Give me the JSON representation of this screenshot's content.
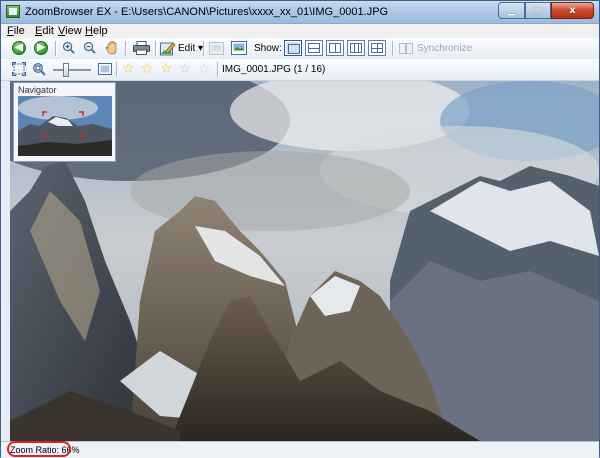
{
  "window": {
    "title": "ZoomBrowser EX - E:\\Users\\CANON\\Pictures\\xxxx_xx_01\\IMG_0001.JPG",
    "min_glyph": "▁",
    "max_glyph": "□",
    "close_glyph": "x"
  },
  "menu": [
    {
      "label": "File",
      "key": "F",
      "rest": "ile"
    },
    {
      "label": "Edit",
      "key": "E",
      "rest": "dit"
    },
    {
      "label": "View",
      "key": "V",
      "rest": "iew"
    },
    {
      "label": "Help",
      "key": "H",
      "rest": "elp"
    }
  ],
  "toolbar": {
    "back_glyph": "◀",
    "forward_glyph": "▶",
    "edit_label": "Edit",
    "edit_arrow": "▾",
    "show_label": "Show:",
    "synchronize_label": "Synchronize",
    "active_view": "single"
  },
  "toolbar2": {
    "zoom_slider_level": 0.35,
    "rating_stars": [
      "☆",
      "☆",
      "☆",
      "☆",
      "☆"
    ],
    "rating_value": 3,
    "file_info": "IMG_0001.JPG (1 / 16)"
  },
  "navigator": {
    "title": "Navigator"
  },
  "status": {
    "zoom_ratio": "Zoom Ratio: 66%"
  },
  "icons": {
    "back": "back-arrow-icon",
    "forward": "forward-arrow-icon",
    "zoom_in": "zoom-in-icon",
    "zoom_out": "zoom-out-icon",
    "hand": "hand-pan-icon",
    "print": "printer-icon",
    "edit": "edit-pencil-icon"
  },
  "colors": {
    "accent": "#2d9a28",
    "highlight_oval": "#e0201a",
    "star": "#f2c21a"
  }
}
